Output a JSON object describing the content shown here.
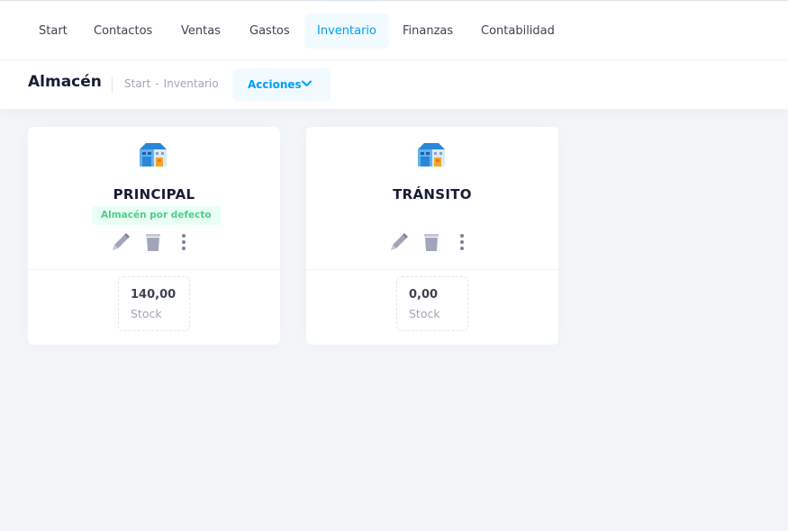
{
  "nav": {
    "items": [
      {
        "label": "Start"
      },
      {
        "label": "Contactos"
      },
      {
        "label": "Ventas"
      },
      {
        "label": "Gastos"
      },
      {
        "label": "Inventario",
        "active": true
      },
      {
        "label": "Finanzas"
      },
      {
        "label": "Contabilidad"
      }
    ]
  },
  "subheader": {
    "title": "Almacén",
    "breadcrumb": [
      "Start",
      "Inventario"
    ],
    "breadcrumb_sep": "-",
    "actions_label": "Acciones",
    "actions_icon": "chevron-down-icon"
  },
  "warehouses": [
    {
      "name": "PRINCIPAL",
      "badge": "Almacén por defecto",
      "stock_value": "140,00",
      "stock_label": "Stock",
      "icons": [
        "warehouse-building-icon",
        "pencil-icon",
        "trash-icon",
        "more-vertical-icon"
      ]
    },
    {
      "name": "TRÁNSITO",
      "stock_value": "0,00",
      "stock_label": "Stock",
      "icons": [
        "warehouse-building-icon",
        "pencil-icon",
        "trash-icon",
        "more-vertical-icon"
      ]
    }
  ],
  "colors": {
    "accent": "#009ef7",
    "accent_bg": "#f1faff",
    "success": "#50cd89",
    "success_bg": "#e8fff3",
    "page_bg": "#f3f6f9",
    "icon_gray": "#a1a5b7"
  }
}
